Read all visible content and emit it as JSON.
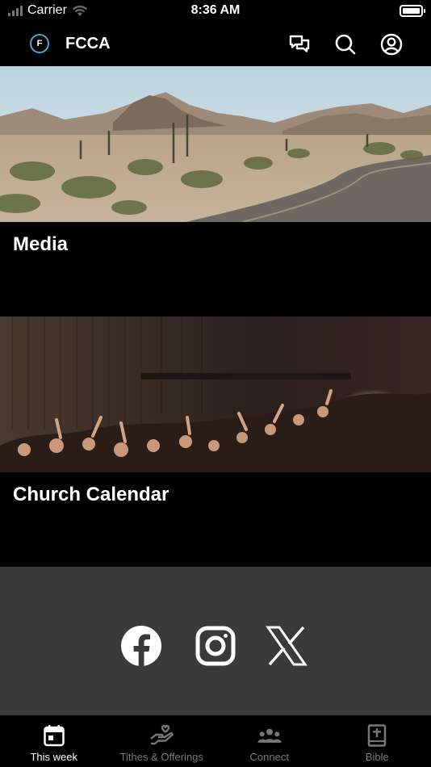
{
  "status_bar": {
    "carrier": "Carrier",
    "time": "8:36 AM"
  },
  "header": {
    "logo_letter": "F",
    "title": "FCCA",
    "icons": [
      "chat-icon",
      "search-icon",
      "profile-icon"
    ]
  },
  "cards": [
    {
      "title": "Media",
      "image": "desert-road-image"
    },
    {
      "title": "Church Calendar",
      "image": "worship-crowd-image"
    }
  ],
  "social": {
    "icons": [
      "facebook-icon",
      "instagram-icon",
      "x-icon"
    ]
  },
  "tabs": [
    {
      "label": "This week",
      "icon": "calendar-icon",
      "active": true
    },
    {
      "label": "Tithes & Offerings",
      "icon": "giving-hand-icon",
      "active": false
    },
    {
      "label": "Connect",
      "icon": "group-icon",
      "active": false
    },
    {
      "label": "Bible",
      "icon": "bible-icon",
      "active": false
    }
  ],
  "colors": {
    "background": "#000000",
    "social_section": "#3a3a3a",
    "tab_inactive": "#777777",
    "logo_accent": "#4aa8d8"
  }
}
